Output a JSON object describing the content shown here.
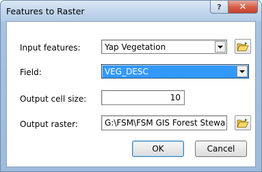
{
  "window": {
    "title": "Features to Raster",
    "help_label": "?",
    "close_label": "✕"
  },
  "form": {
    "input_features": {
      "label": "Input features:",
      "value": "Yap Vegetation"
    },
    "field": {
      "label": "Field:",
      "value": "VEG_DESC"
    },
    "cell_size": {
      "label": "Output cell size:",
      "value": "10"
    },
    "output_raster": {
      "label": "Output raster:",
      "value": "G:\\FSM\\FSM GIS Forest Stewa"
    }
  },
  "buttons": {
    "ok_label": "OK",
    "cancel_label": "Cancel"
  },
  "icons": {
    "folder": "open-folder-icon",
    "dropdown": "chevron-down-icon"
  }
}
